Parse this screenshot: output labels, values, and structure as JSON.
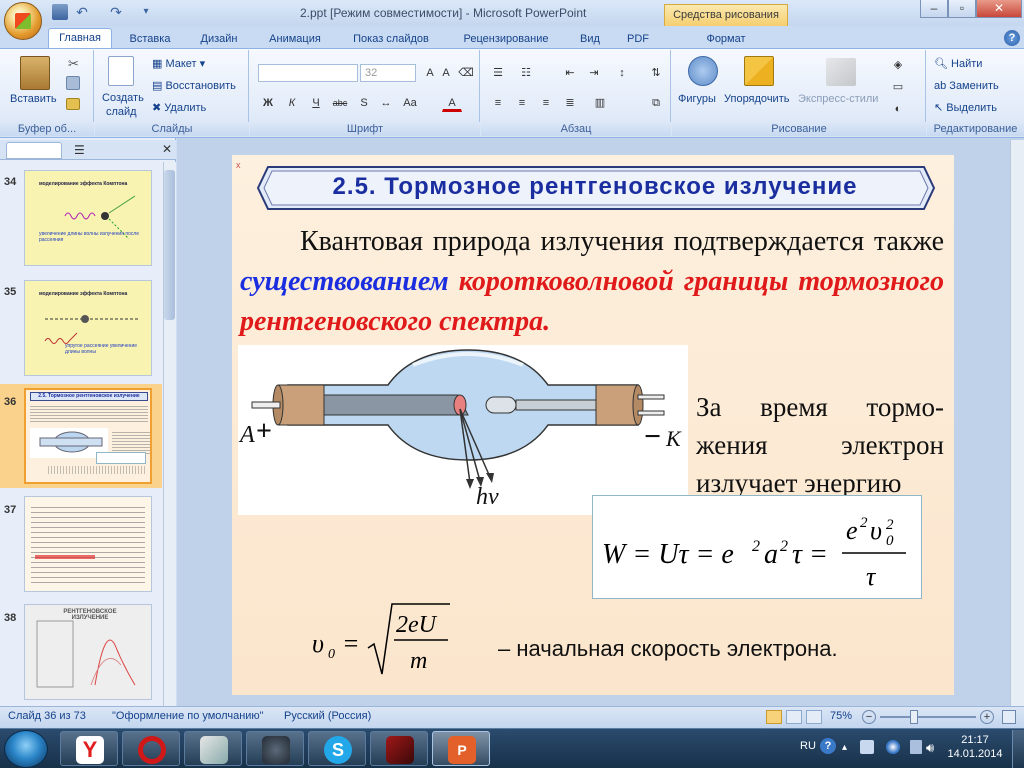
{
  "window": {
    "title": "2.ppt [Режим совместимости] - Microsoft PowerPoint",
    "context_tab_group": "Средства рисования"
  },
  "tabs": [
    "Главная",
    "Вставка",
    "Дизайн",
    "Анимация",
    "Показ слайдов",
    "Рецензирование",
    "Вид",
    "PDF",
    "Формат"
  ],
  "ribbon": {
    "groups": {
      "clipboard": "Буфер об...",
      "slides": "Слайды",
      "font": "Шрифт",
      "paragraph": "Абзац",
      "drawing": "Рисование",
      "editing": "Редактирование"
    },
    "paste": "Вставить",
    "create_slide_1": "Создать",
    "create_slide_2": "слайд",
    "layout": "Макет",
    "reset": "Восстановить",
    "delete": "Удалить",
    "font_size": "32",
    "shapes": "Фигуры",
    "arrange": "Упорядочить",
    "quick_styles": "Экспресс-стили",
    "find": "Найти",
    "replace": "Заменить",
    "select": "Выделить",
    "font_buttons": [
      "Ж",
      "К",
      "Ч",
      "abc",
      "S"
    ]
  },
  "thumbnails": [
    {
      "num": "34"
    },
    {
      "num": "35"
    },
    {
      "num": "36"
    },
    {
      "num": "37"
    },
    {
      "num": "38"
    }
  ],
  "thumb_texts": {
    "t34a": "моделирование эффекта Комптона",
    "t34b": "увеличение длины волны излучения после рассеяния",
    "t35a": "моделирование эффекта Комптона",
    "t35b": "упругое рассеяние увеличение длины волны",
    "t38": "РЕНТГЕНОВСКОЕ ИЗЛУЧЕНИЕ"
  },
  "slide": {
    "title": "2.5. Тормозное рентгеновское излучение",
    "para_1": "Квантовая природа излучения подтверждается также",
    "para_blue": "существованием",
    "para_red1": "коротковолновой",
    "para_red2": "границы тормозного рентгеновского спектра.",
    "side_text": "За время тормо-жения электрон излучает энергию",
    "label_anode": "A",
    "label_cathode": "K",
    "label_plus": "+",
    "label_minus": "−",
    "label_hv": "hν",
    "velocity_caption": "– начальная скорость электрона.",
    "corner_x": "x"
  },
  "status": {
    "slide_count": "Слайд 36 из 73",
    "theme": "\"Оформление по умолчанию\"",
    "language": "Русский (Россия)",
    "zoom": "75%"
  },
  "taskbar": {
    "lang": "RU",
    "time": "21:17",
    "date": "14.01.2014"
  },
  "colors": {
    "title_blue": "#1a2ea0",
    "accent_blue": "#1a2ee0",
    "accent_red": "#e01a1a"
  }
}
